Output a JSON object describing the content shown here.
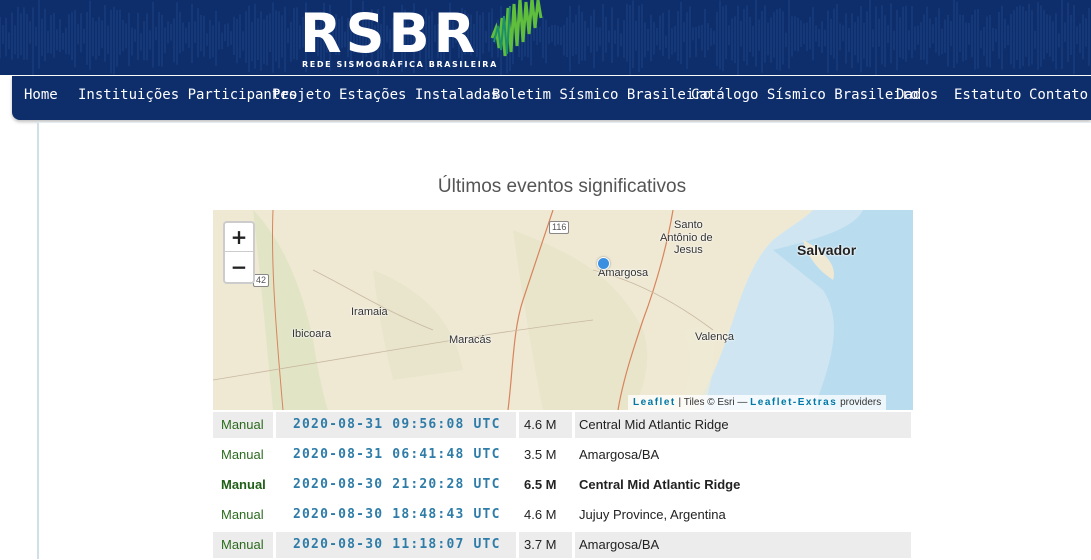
{
  "header": {
    "logo_title": "RSBR",
    "logo_subtitle": "REDE SISMOGRÁFICA BRASILEIRA"
  },
  "nav": {
    "items": [
      {
        "label": "Home"
      },
      {
        "label": "Instituições Participantes"
      },
      {
        "label": "Projeto"
      },
      {
        "label": "Estações Instaladas"
      },
      {
        "label": "Boletim Sísmico Brasileiro"
      },
      {
        "label": "Catálogo Sísmico Brasileiro"
      },
      {
        "label": "Dados"
      },
      {
        "label": "Estatuto"
      },
      {
        "label": "Contato"
      }
    ]
  },
  "section": {
    "title": "Últimos eventos significativos"
  },
  "map": {
    "zoom_in": "+",
    "zoom_out": "−",
    "labels": {
      "salvador": "Salvador",
      "santo_1": "Santo",
      "santo_2": "Antônio de",
      "santo_3": "Jesus",
      "amargosa": "Amargosa",
      "iramaia": "Iramaia",
      "ibicoara": "Ibicoara",
      "maracas": "Maracás",
      "valenca": "Valença",
      "route_116": "116",
      "route_42": "42"
    },
    "attribution": {
      "leaflet": "Leaflet",
      "tiles": "| Tiles © Esri —",
      "extras": "Leaflet-Extras",
      "providers": "providers"
    },
    "colors": {
      "land": "#efe9d4",
      "water": "#cfe6f2",
      "marker": "#3b8fe0"
    }
  },
  "events": [
    {
      "type": "Manual",
      "datetime": "2020-08-31  09:56:08  UTC",
      "magnitude": "4.6 M",
      "place": "Central Mid Atlantic Ridge",
      "shaded": true,
      "bold": false
    },
    {
      "type": "Manual",
      "datetime": "2020-08-31  06:41:48  UTC",
      "magnitude": "3.5 M",
      "place": "Amargosa/BA",
      "shaded": false,
      "bold": false
    },
    {
      "type": "Manual",
      "datetime": "2020-08-30  21:20:28  UTC",
      "magnitude": "6.5 M",
      "place": "Central Mid Atlantic Ridge",
      "shaded": false,
      "bold": true
    },
    {
      "type": "Manual",
      "datetime": "2020-08-30  18:48:43  UTC",
      "magnitude": "4.6 M",
      "place": "Jujuy Province, Argentina",
      "shaded": false,
      "bold": false
    },
    {
      "type": "Manual",
      "datetime": "2020-08-30  11:18:07  UTC",
      "magnitude": "3.7 M",
      "place": "Amargosa/BA",
      "shaded": true,
      "bold": false
    }
  ]
}
